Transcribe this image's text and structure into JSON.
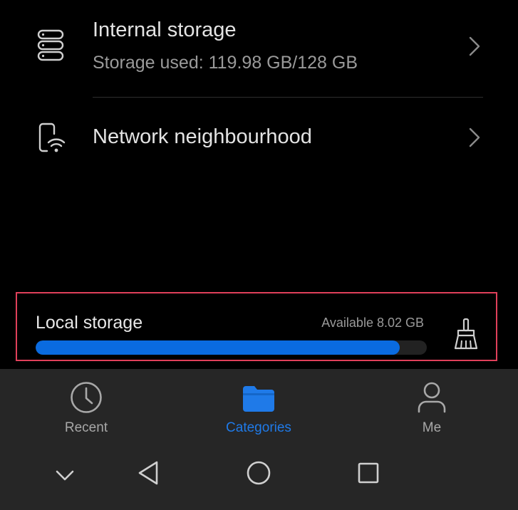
{
  "storage_list": {
    "internal": {
      "title": "Internal storage",
      "subtitle": "Storage used: 119.98 GB/128 GB",
      "icon": "storage-stack-icon"
    },
    "network": {
      "title": "Network neighbourhood",
      "icon": "phone-wifi-icon"
    }
  },
  "local_storage": {
    "label": "Local storage",
    "available": "Available 8.02 GB",
    "used_fraction": 0.93,
    "icon": "broom-clean-icon"
  },
  "bottom_nav": {
    "items": [
      {
        "label": "Recent",
        "icon": "clock-icon",
        "active": false
      },
      {
        "label": "Categories",
        "icon": "folder-icon",
        "active": true
      },
      {
        "label": "Me",
        "icon": "person-icon",
        "active": false
      }
    ]
  },
  "system_nav": {
    "buttons": [
      "chevron-down-icon",
      "back-triangle-icon",
      "home-circle-icon",
      "recents-square-icon"
    ]
  },
  "colors": {
    "accent": "#1f7ae8",
    "progress": "#0a6be0",
    "highlight_border": "#e0405a",
    "background": "#000000",
    "nav_background": "#262626"
  }
}
